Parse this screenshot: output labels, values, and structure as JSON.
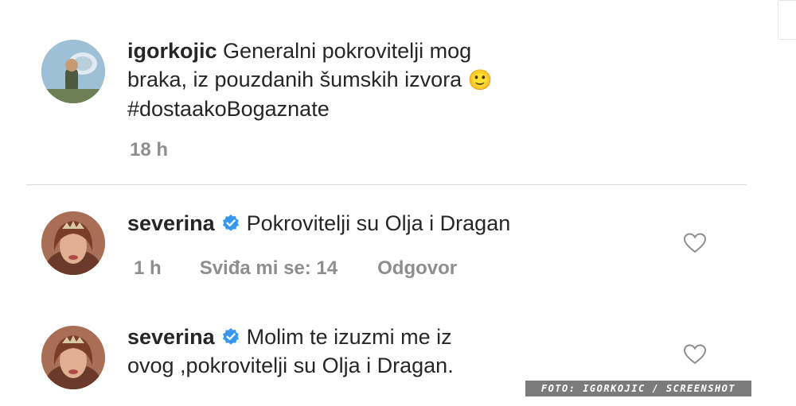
{
  "post": {
    "username": "igorkojic",
    "caption_line1": "Generalni pokrovitelji mog",
    "caption_line2": "braka, iz pouzdanih šumskih izvora",
    "emoji": "🙂",
    "hashtag": "#dostaakoBogaznate",
    "time": "18 h"
  },
  "comments": [
    {
      "username": "severina",
      "text": "Pokrovitelji su Olja i Dragan",
      "time": "1 h",
      "likes": "Sviđa mi se: 14",
      "reply": "Odgovor"
    },
    {
      "username": "severina",
      "text_line1": "Molim te izuzmi me iz",
      "text_line2": "ovog ,pokrovitelji su Olja i Dragan."
    }
  ],
  "watermark": "FOTO: IGORKOJIC / SCREENSHOT",
  "colors": {
    "text": "#262626",
    "meta": "#8e8e8e",
    "verified": "#3897f0",
    "divider": "#dbdbdb"
  },
  "icons": [
    "avatar-igorkojic",
    "avatar-severina",
    "verified-badge-icon",
    "heart-icon"
  ]
}
